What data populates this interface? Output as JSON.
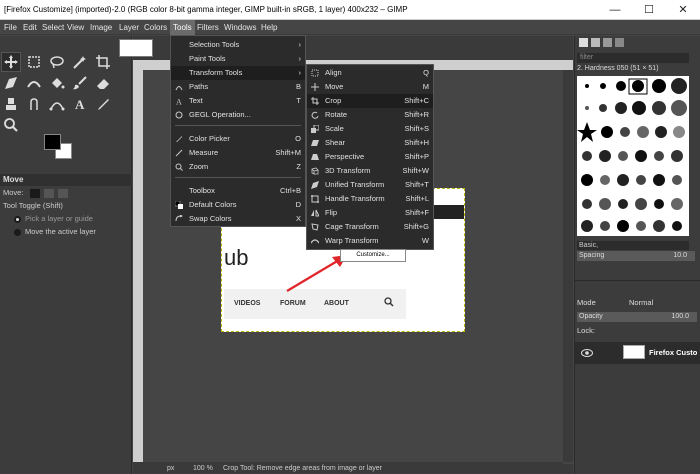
{
  "window": {
    "title": "[Firefox Customize] (imported)-2.0 (RGB color 8-bit gamma integer, GIMP built-in sRGB, 1 layer) 400x232 – GIMP",
    "minimize": "—",
    "maximize": "☐",
    "close": "✕"
  },
  "menubar": [
    "File",
    "Edit",
    "Select",
    "View",
    "Image",
    "Layer",
    "Colors",
    "Tools",
    "Filters",
    "Windows",
    "Help"
  ],
  "tool_options": {
    "header": "Move",
    "move_label": "Move:",
    "toggle_label": "Tool Toggle  (Shift)",
    "opt1": "Pick a layer or guide",
    "opt2": "Move the active layer"
  },
  "tools_menu": [
    {
      "label": "Selection Tools",
      "shortcut": "",
      "submenu": true
    },
    {
      "label": "Paint Tools",
      "shortcut": "",
      "submenu": true
    },
    {
      "label": "Transform Tools",
      "shortcut": "",
      "submenu": true
    },
    {
      "label": "Paths",
      "shortcut": "B"
    },
    {
      "label": "Text",
      "shortcut": "T"
    },
    {
      "label": "GEGL Operation...",
      "shortcut": ""
    },
    {
      "label": "Color Picker",
      "shortcut": "O"
    },
    {
      "label": "Measure",
      "shortcut": "Shift+M"
    },
    {
      "label": "Zoom",
      "shortcut": "Z"
    },
    {
      "label": "Toolbox",
      "shortcut": "Ctrl+B"
    },
    {
      "label": "Default Colors",
      "shortcut": "D"
    },
    {
      "label": "Swap Colors",
      "shortcut": "X"
    }
  ],
  "transform_menu": [
    {
      "label": "Align",
      "shortcut": "Q"
    },
    {
      "label": "Move",
      "shortcut": "M"
    },
    {
      "label": "Crop",
      "shortcut": "Shift+C"
    },
    {
      "label": "Rotate",
      "shortcut": "Shift+R"
    },
    {
      "label": "Scale",
      "shortcut": "Shift+S"
    },
    {
      "label": "Shear",
      "shortcut": "Shift+H"
    },
    {
      "label": "Perspective",
      "shortcut": "Shift+P"
    },
    {
      "label": "3D Transform",
      "shortcut": "Shift+W"
    },
    {
      "label": "Unified Transform",
      "shortcut": "Shift+T"
    },
    {
      "label": "Handle Transform",
      "shortcut": "Shift+L"
    },
    {
      "label": "Flip",
      "shortcut": "Shift+F"
    },
    {
      "label": "Cage Transform",
      "shortcut": "Shift+G"
    },
    {
      "label": "Warp Transform",
      "shortcut": "W"
    }
  ],
  "image_content": {
    "ub": "ub",
    "customize": "Customize...",
    "nav_videos": "VIDEOS",
    "nav_forum": "FORUM",
    "nav_about": "ABOUT"
  },
  "statusbar": {
    "unit": "px",
    "zoom": "100 %",
    "message": "Crop Tool: Remove edge areas from image or layer"
  },
  "brushes": {
    "filter_placeholder": "filter",
    "brush_name": "2. Hardness 050 (51 × 51)",
    "tag": "Basic,",
    "spacing_label": "Spacing",
    "spacing_value": "10.0"
  },
  "layers": {
    "mode_label": "Mode",
    "mode_value": "Normal",
    "opacity_label": "Opacity",
    "opacity_value": "100.0",
    "lock_label": "Lock:",
    "layer_name": "Firefox Custo"
  },
  "colors": {
    "accent_arrow": "#e0262b",
    "menu_bg": "#2b2b2b",
    "highlight": "#1e1e1e"
  }
}
